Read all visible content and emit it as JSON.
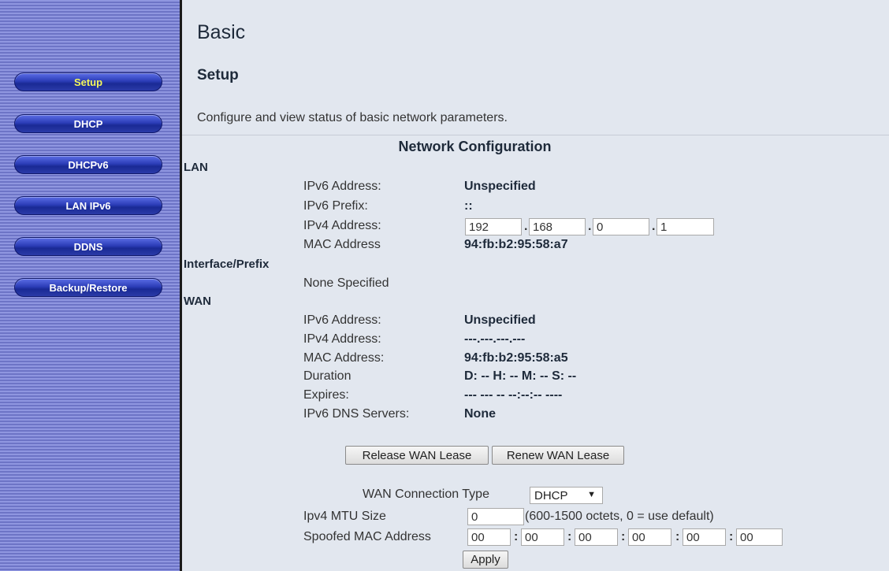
{
  "sidebar": {
    "items": [
      {
        "label": "Setup",
        "active": true
      },
      {
        "label": "DHCP"
      },
      {
        "label": "DHCPv6"
      },
      {
        "label": "LAN IPv6"
      },
      {
        "label": "DDNS"
      },
      {
        "label": "Backup/Restore"
      }
    ]
  },
  "header": {
    "title": "Basic",
    "section": "Setup",
    "description": "Configure and view status of basic network parameters."
  },
  "config": {
    "title": "Network Configuration",
    "lan": {
      "title": "LAN",
      "ipv6_address_label": "IPv6 Address:",
      "ipv6_address": "Unspecified",
      "ipv6_prefix_label": "IPv6 Prefix:",
      "ipv6_prefix": "::",
      "ipv4_address_label": "IPv4 Address:",
      "ipv4_octets": [
        "192",
        "168",
        "0",
        "1"
      ],
      "mac_label": "MAC Address",
      "mac": "94:fb:b2:95:58:a7"
    },
    "iface": {
      "title": "Interface/Prefix",
      "value": "None Specified"
    },
    "wan": {
      "title": "WAN",
      "ipv6_address_label": "IPv6 Address:",
      "ipv6_address": "Unspecified",
      "ipv4_address_label": "IPv4 Address:",
      "ipv4_address": "---.---.---.---",
      "mac_label": "MAC Address:",
      "mac": "94:fb:b2:95:58:a5",
      "duration_label": "Duration",
      "duration": "D: -- H: -- M: -- S: --",
      "expires_label": "Expires:",
      "expires": "--- --- -- --:--:-- ----",
      "dns_label": "IPv6 DNS Servers:",
      "dns": "None"
    },
    "release_button": "Release WAN Lease",
    "renew_button": "Renew WAN Lease",
    "conn_type_label": "WAN Connection Type",
    "conn_type": "DHCP",
    "mtu_label": "Ipv4 MTU Size",
    "mtu_value": "0",
    "mtu_hint": "(600-1500 octets, 0 = use default)",
    "spoof_label": "Spoofed MAC Address",
    "spoof_octets": [
      "00",
      "00",
      "00",
      "00",
      "00",
      "00"
    ],
    "apply_button": "Apply"
  },
  "colors": {
    "sidebar_bg": "#7f86d6",
    "button_blue": "#2c3db8",
    "active_label": "#f4f75a",
    "main_bg": "#e2e7ef"
  }
}
